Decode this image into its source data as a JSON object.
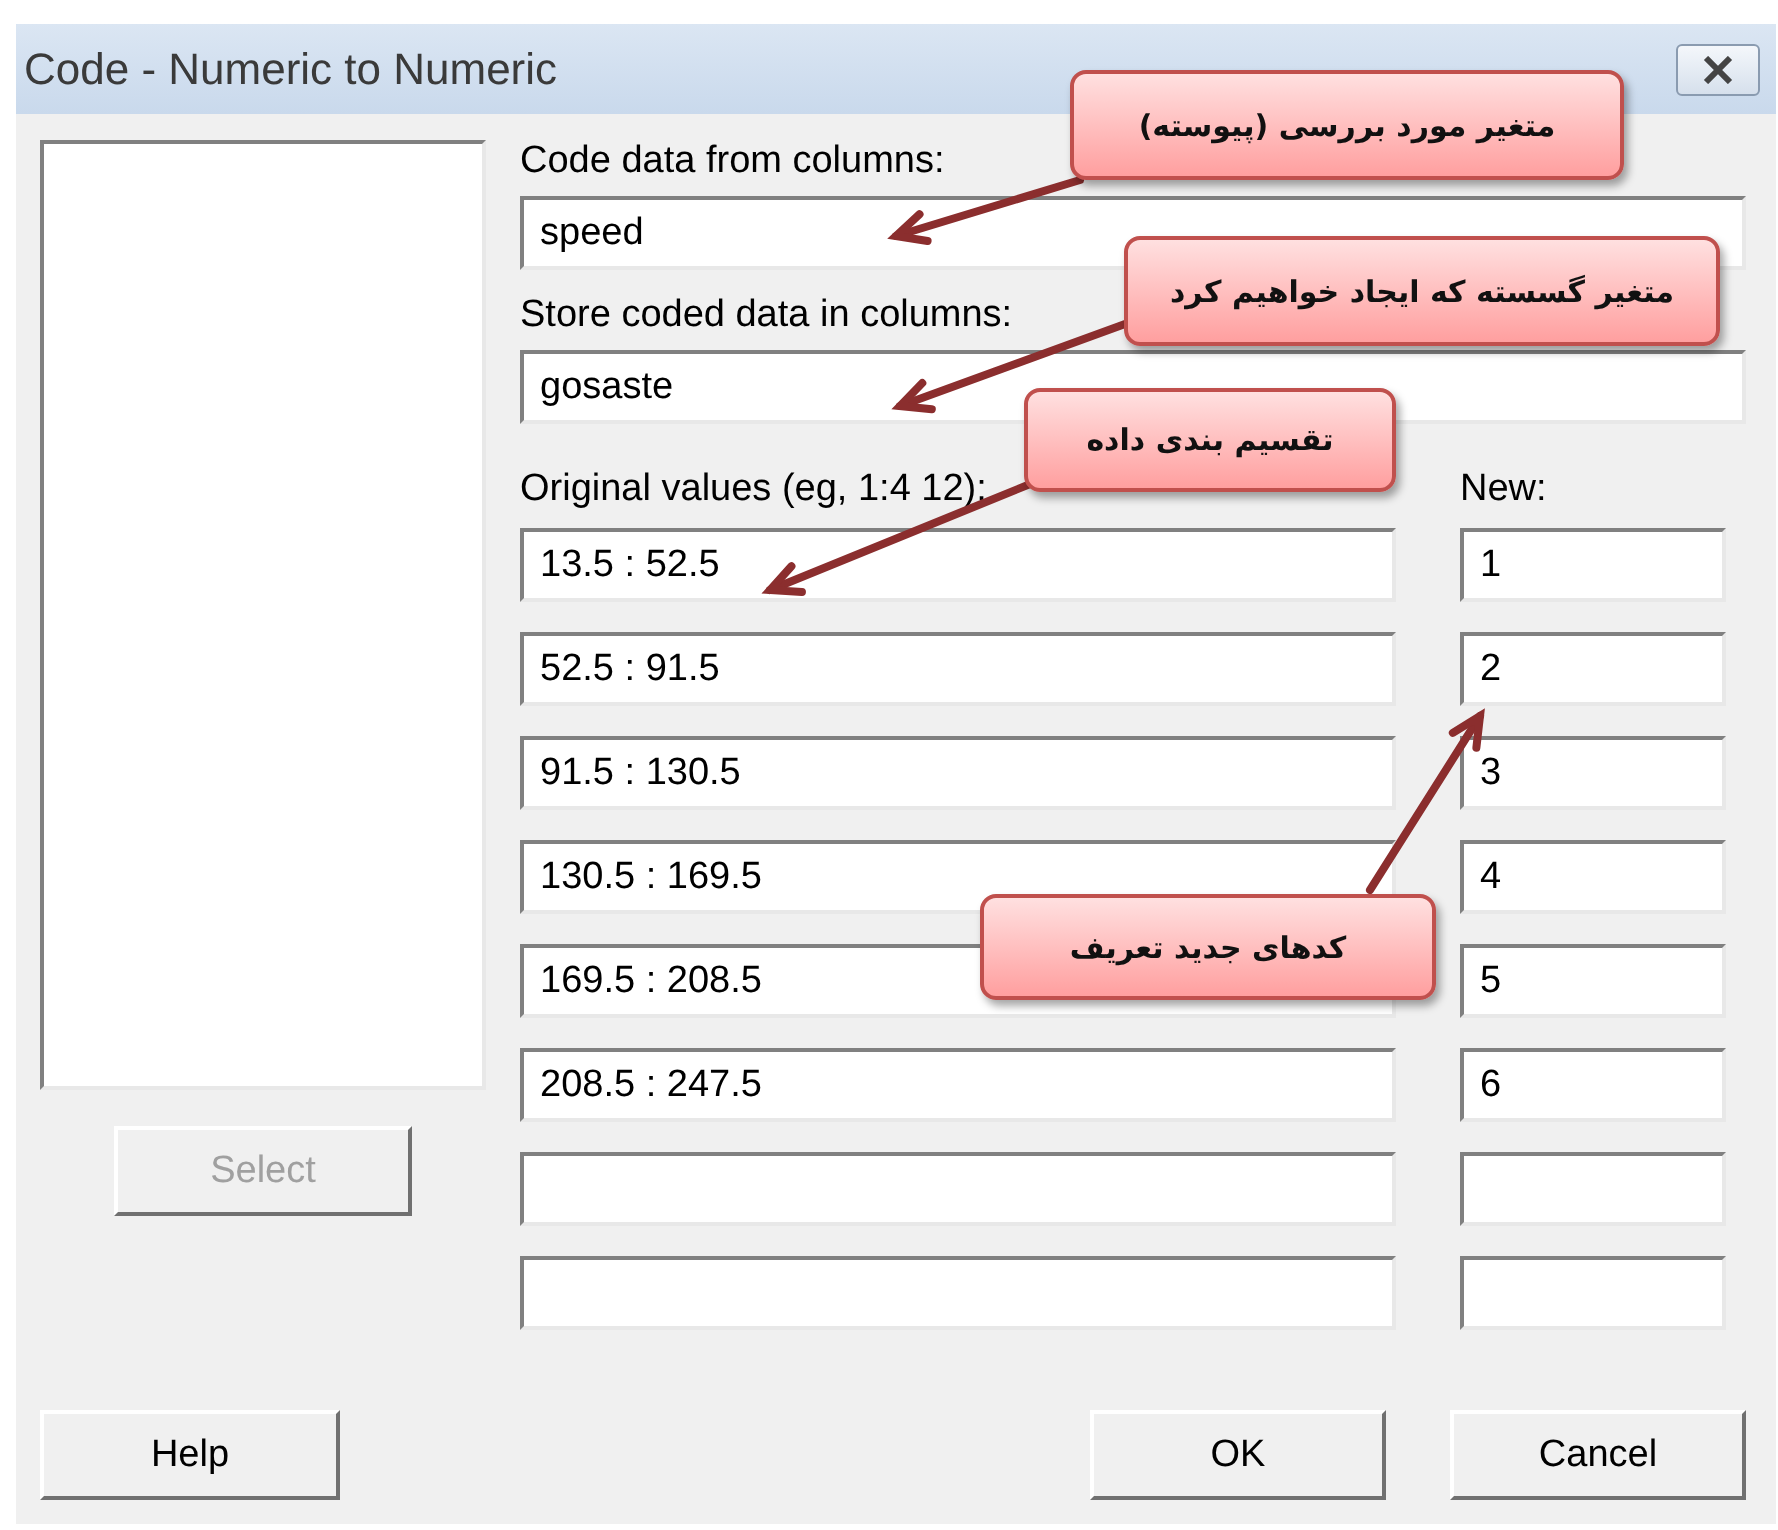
{
  "window": {
    "title": "Code - Numeric to Numeric"
  },
  "select_button": {
    "label": "Select",
    "disabled": true
  },
  "fields": [
    {
      "label": "Code data from columns:",
      "value": "speed"
    },
    {
      "label": "Store coded data in columns:",
      "value": "gosaste"
    }
  ],
  "table": {
    "columns": [
      "Original values (eg,  1:4  12):",
      "New:"
    ],
    "rows": [
      {
        "original": "13.5 : 52.5",
        "new": "1"
      },
      {
        "original": "52.5 : 91.5",
        "new": "2"
      },
      {
        "original": "91.5 : 130.5",
        "new": "3"
      },
      {
        "original": "130.5 : 169.5",
        "new": "4"
      },
      {
        "original": "169.5 : 208.5",
        "new": "5"
      },
      {
        "original": "208.5 : 247.5",
        "new": "6"
      },
      {},
      {}
    ]
  },
  "buttons": {
    "left": [
      {
        "label": "Help"
      }
    ],
    "right": [
      {
        "label": "OK"
      },
      {
        "label": "Cancel"
      }
    ]
  },
  "annotations": [
    {
      "text": "متغیر مورد بررسی (پیوسته)"
    },
    {
      "text": "متغیر گسسته که ایجاد خواهیم کرد"
    },
    {
      "text": "تقسیم بندی داده"
    },
    {
      "text": "کدهای جدید تعریف"
    }
  ]
}
